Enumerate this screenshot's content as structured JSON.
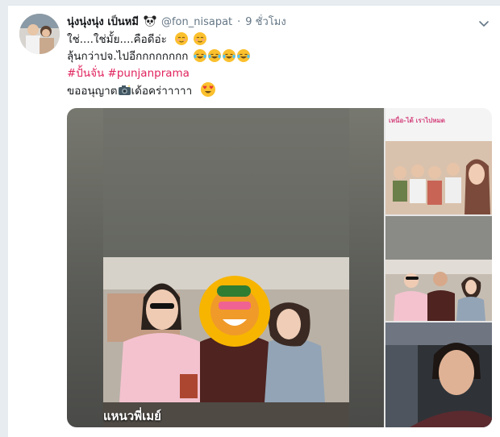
{
  "tweet": {
    "display_name": "นุ่งนุ่งนุ่ง เป็นหมี",
    "handle": "@fon_nisapat",
    "separator": "·",
    "time": "9 ชั่วโมง",
    "lines": [
      "ใช่....ใช่มั้ย....คือดีอ่ะ",
      "ลุ้นกว่าปจ.ไปอีกกกกกกกก",
      "ขออนุญาต",
      "เด้อคร่าาาาา"
    ],
    "hashtags": [
      "#ปั้นจั่น",
      "#punjanprama"
    ],
    "icons": {
      "menu": "chevron-down-icon",
      "avatar": "avatar",
      "panda": "panda-icon",
      "blush": "blush-emoji-icon",
      "laugh": "tears-of-joy-emoji-icon",
      "camera": "camera-flash-icon",
      "heart_eyes": "heart-eyes-emoji-icon"
    },
    "colors": {
      "hashtag": "#e0245e",
      "muted": "#657786",
      "name": "#14171a"
    }
  },
  "media": {
    "sticker_caption": "เหนื่อ-ได้ เราไปหมด",
    "overlay_caption": "แหนวพี่เมย์"
  }
}
